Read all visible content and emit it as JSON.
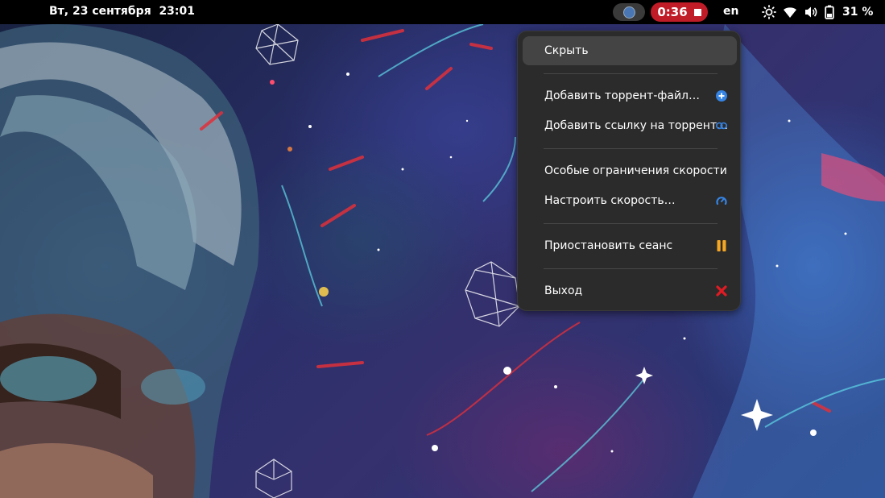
{
  "topbar": {
    "clock": "Вт, 23 сентября  23:01",
    "recording_time": "0:36",
    "language": "en",
    "battery": "31 %"
  },
  "menu": {
    "items": [
      {
        "label": "Скрыть",
        "icon": null
      },
      {
        "label": "Добавить торрент-файл…",
        "icon": "add-circle-icon",
        "color": "#3584e4"
      },
      {
        "label": "Добавить ссылку на торрент…",
        "icon": "link-icon",
        "color": "#3584e4"
      },
      {
        "label": "Особые ограничения скорости",
        "icon": null
      },
      {
        "label": "Настроить скорость…",
        "icon": "speedometer-icon",
        "color": "#3584e4"
      },
      {
        "label": "Приостановить сеанс",
        "icon": "pause-icon",
        "color": "#f5a623"
      },
      {
        "label": "Выход",
        "icon": "close-x-icon",
        "color": "#e01b24"
      }
    ]
  },
  "colors": {
    "recording": "#c01c28",
    "menu_bg": "#2b2b2b",
    "hover": "#444444"
  }
}
